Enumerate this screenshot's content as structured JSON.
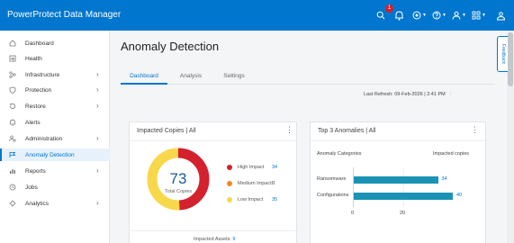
{
  "app": {
    "title": "PowerProtect Data Manager",
    "notification_count": "1"
  },
  "topbar_icons": [
    "search-icon",
    "bell-icon",
    "jobs-icon",
    "help-icon",
    "user-icon",
    "apps-icon",
    "settings-icon"
  ],
  "sidebar": {
    "items": [
      {
        "label": "Dashboard",
        "icon": "home-icon",
        "has_children": false
      },
      {
        "label": "Health",
        "icon": "health-icon",
        "has_children": false
      },
      {
        "label": "Infrastructure",
        "icon": "infrastructure-icon",
        "has_children": true
      },
      {
        "label": "Protection",
        "icon": "shield-icon",
        "has_children": true
      },
      {
        "label": "Restore",
        "icon": "restore-icon",
        "has_children": true
      },
      {
        "label": "Alerts",
        "icon": "bell-icon",
        "has_children": false
      },
      {
        "label": "Administration",
        "icon": "admin-icon",
        "has_children": true
      },
      {
        "label": "Anomaly Detection",
        "icon": "anomaly-icon",
        "has_children": false,
        "active": true
      },
      {
        "label": "Reports",
        "icon": "reports-icon",
        "has_children": true
      },
      {
        "label": "Jobs",
        "icon": "clock-icon",
        "has_children": false
      },
      {
        "label": "Analytics",
        "icon": "analytics-icon",
        "has_children": true
      }
    ],
    "chevron": "›"
  },
  "main": {
    "title": "Anomaly Detection",
    "tabs": [
      {
        "label": "Dashboard",
        "active": true
      },
      {
        "label": "Analysis",
        "active": false
      },
      {
        "label": "Settings",
        "active": false
      }
    ],
    "last_refresh": "Last Refresh: 09-Feb-2026 | 2:41 PM",
    "refresh_more": "⋮"
  },
  "impacted_copies": {
    "title": "Impacted Copies | All",
    "menu": "⋮",
    "total_value": "73",
    "total_label": "Total Copies",
    "legend": [
      {
        "label": "High Impact",
        "value": "34",
        "color": "#d3212d"
      },
      {
        "label": "Medium Impact",
        "value": "0",
        "color": "#f08a24"
      },
      {
        "label": "Low Impact",
        "value": "35",
        "color": "#f7d84b"
      }
    ],
    "footer_label": "Impacted Assets:",
    "footer_value": "9"
  },
  "top_anomalies": {
    "title": "Top 3 Anomalies | All",
    "menu": "⋮",
    "col_left": "Anomaly Categories",
    "col_right": "Impacted copies",
    "bar_color": "#1a93b5"
  },
  "chart_data": {
    "type": "bar",
    "orientation": "horizontal",
    "categories": [
      "Ransomware",
      "Configurations"
    ],
    "values": [
      34,
      40
    ],
    "xticks": [
      "0",
      "20"
    ],
    "xlim": [
      0,
      44
    ],
    "title": "",
    "xlabel": "",
    "ylabel": ""
  },
  "feedback_label": "Feedback"
}
